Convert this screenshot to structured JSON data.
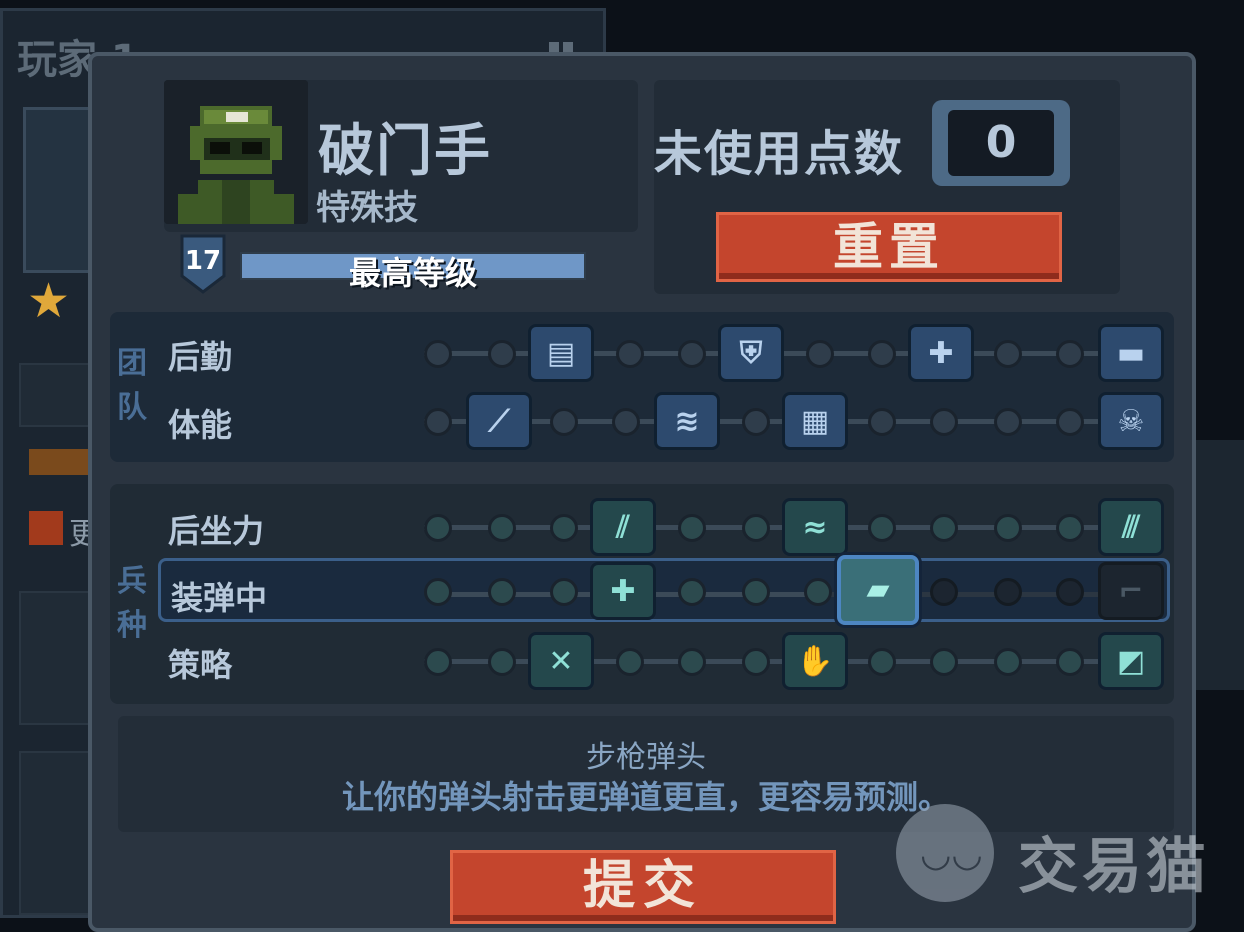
{
  "background_panel": {
    "title": "玩家 1",
    "more_label": "更"
  },
  "class_info": {
    "name": "破门手",
    "subtitle": "特殊技",
    "level": "17",
    "level_text": "最高等级",
    "xp_progress": 1.0
  },
  "points": {
    "label": "未使用点数",
    "value": "0",
    "reset_label": "重置"
  },
  "skill_groups": [
    {
      "label": "团队",
      "rows": [
        {
          "label": "后勤",
          "perks": [
            "ammo-crate-icon",
            "shield-plus-icon",
            "medkit-icon",
            "supply-box-icon"
          ]
        },
        {
          "label": "体能",
          "perks": [
            "knife-icon",
            "sprint-icon",
            "armor-plates-icon",
            "skull-icon"
          ]
        }
      ]
    },
    {
      "label": "兵种",
      "rows": [
        {
          "label": "后坐力",
          "perks": [
            "recoil-icon",
            "stabilizer-icon",
            "spread-icon"
          ]
        },
        {
          "label": "装弹中",
          "perks": [
            "plus-ammo-icon",
            "rifle-slug-icon",
            "locked-gun-icon"
          ]
        },
        {
          "label": "策略",
          "perks": [
            "shrapnel-icon",
            "glove-icon",
            "shield-icon"
          ]
        }
      ]
    }
  ],
  "description": {
    "title": "步枪弹头",
    "text": "让你的弹头射击更弹道更直，更容易预测。"
  },
  "submit_label": "提交",
  "watermark": {
    "text": "交易猫"
  },
  "colors": {
    "accent_red": "#c4452d",
    "accent_blue": "#4d86c2",
    "teal": "#8fe0d6"
  }
}
